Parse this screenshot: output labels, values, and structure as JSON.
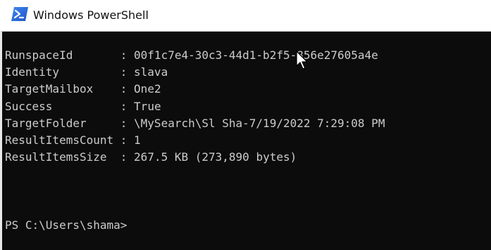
{
  "window": {
    "title": "Windows PowerShell",
    "icon": "powershell-icon"
  },
  "console": {
    "fields": [
      {
        "key": "RunspaceId",
        "sep": " : ",
        "value": "00f1c7e4-30c3-44d1-b2f5-856e27605a4e"
      },
      {
        "key": "Identity",
        "sep": " : ",
        "value": "slava"
      },
      {
        "key": "TargetMailbox",
        "sep": " : ",
        "value": "One2"
      },
      {
        "key": "Success",
        "sep": " : ",
        "value": "True"
      },
      {
        "key": "TargetFolder",
        "sep": " : ",
        "value": "\\MySearch\\Sl Sha-7/19/2022 7:29:08 PM"
      },
      {
        "key": "ResultItemsCount",
        "sep": " : ",
        "value": "1"
      },
      {
        "key": "ResultItemsSize",
        "sep": " : ",
        "value": "267.5 KB (273,890 bytes)"
      }
    ],
    "prompt": "PS C:\\Users\\shama>"
  },
  "colors": {
    "console_bg": "#0c0c0c",
    "console_text": "#cccccc",
    "icon_blue": "#2b6bd8"
  }
}
